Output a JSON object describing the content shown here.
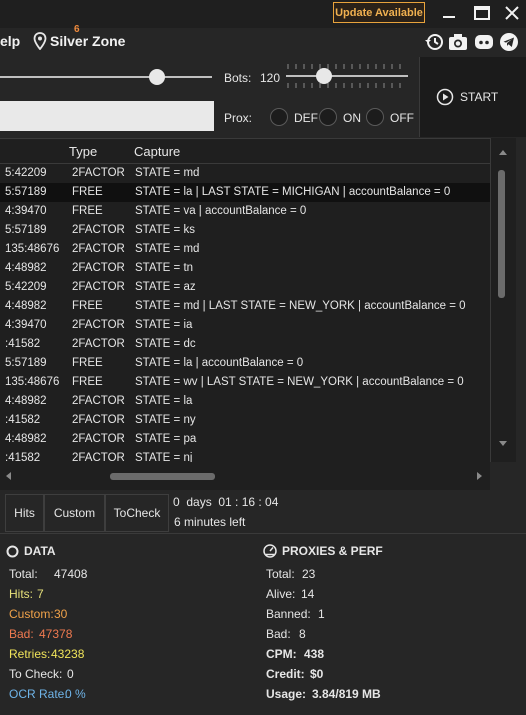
{
  "titlebar": {
    "update_label": "Update Available",
    "accent": "#e8a33c"
  },
  "nav": {
    "help_label": "elp",
    "help_prefix": "H",
    "zone_label": "Silver Zone",
    "zone_badge": "6",
    "icons": [
      "history-icon",
      "camera-icon",
      "discord-icon",
      "telegram-icon"
    ]
  },
  "controls": {
    "bots_label": "Bots:",
    "bots_value": "120",
    "prox_label": "Prox:",
    "prox_options": [
      "DEF",
      "ON",
      "OFF"
    ],
    "start_label": "START"
  },
  "table": {
    "headers": [
      "Type",
      "Capture"
    ],
    "rows": [
      [
        "5:42209",
        "2FACTOR",
        "STATE = md"
      ],
      [
        "5:57189",
        "FREE",
        "STATE = la | LAST STATE = MICHIGAN | accountBalance = 0"
      ],
      [
        "4:39470",
        "FREE",
        "STATE = va | accountBalance = 0"
      ],
      [
        "5:57189",
        "2FACTOR",
        "STATE = ks"
      ],
      [
        "135:48676",
        "2FACTOR",
        "STATE = md"
      ],
      [
        "4:48982",
        "2FACTOR",
        "STATE = tn"
      ],
      [
        "5:42209",
        "2FACTOR",
        "STATE = az"
      ],
      [
        "4:48982",
        "FREE",
        "STATE = md | LAST STATE = NEW_YORK | accountBalance = 0"
      ],
      [
        "4:39470",
        "2FACTOR",
        "STATE = ia"
      ],
      [
        ":41582",
        "2FACTOR",
        "STATE = dc"
      ],
      [
        "5:57189",
        "FREE",
        "STATE = la | accountBalance = 0"
      ],
      [
        "135:48676",
        "FREE",
        "STATE = wv | LAST STATE = NEW_YORK | accountBalance = 0"
      ],
      [
        "4:48982",
        "2FACTOR",
        "STATE = la"
      ],
      [
        ":41582",
        "2FACTOR",
        "STATE = ny"
      ],
      [
        "4:48982",
        "2FACTOR",
        "STATE = pa"
      ],
      [
        ":41582",
        "2FACTOR",
        "STATE = nj"
      ]
    ],
    "selected_row": 1
  },
  "tabs": [
    "Hits",
    "Custom",
    "ToCheck"
  ],
  "timer": {
    "line": "0  days  01 : 16 : 04",
    "left": "6 minutes left"
  },
  "data_section": {
    "title": "DATA",
    "stats": [
      {
        "label": "Total:",
        "value": "47408",
        "color": "#e6e6e6"
      },
      {
        "label": "Hits:",
        "value": "7",
        "color": "#e6e07a"
      },
      {
        "label": "Custom:",
        "value": "30",
        "color": "#f0a24a"
      },
      {
        "label": "Bad:",
        "value": "47378",
        "color": "#f07a50"
      },
      {
        "label": "Retries:",
        "value": "43238",
        "color": "#f0e45a"
      },
      {
        "label": "To Check:",
        "value": "0",
        "color": "#e6e6e6"
      },
      {
        "label": "OCR Rate:",
        "value": "0 %",
        "color": "#6fb4e8"
      }
    ]
  },
  "proxies_section": {
    "title": "PROXIES & PERF",
    "stats": [
      {
        "label": "Total:",
        "value": "23"
      },
      {
        "label": "Alive:",
        "value": "14"
      },
      {
        "label": "Banned:",
        "value": "1"
      },
      {
        "label": "Bad:",
        "value": "8"
      },
      {
        "label": "CPM:",
        "value": "438"
      },
      {
        "label": "Credit:",
        "value": "$0"
      },
      {
        "label": "Usage:",
        "value": "3.84/819 MB"
      }
    ]
  }
}
